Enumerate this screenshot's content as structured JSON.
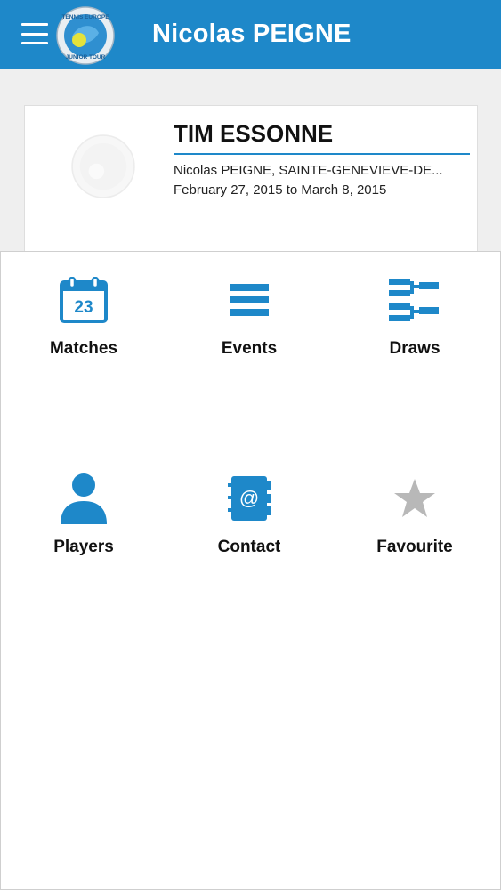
{
  "header": {
    "title": "Nicolas PEIGNE",
    "logo_text_top": "TENNIS EUROPE",
    "logo_text_bottom": "JUNIOR TOUR",
    "color": "#1e88c9"
  },
  "tournament": {
    "name": "TIM ESSONNE",
    "organizer_location": "Nicolas PEIGNE, SAINTE-GENEVIEVE-DE...",
    "dates": "February 27, 2015 to March 8, 2015"
  },
  "menu": {
    "items": [
      {
        "label": "Matches",
        "icon": "calendar-icon",
        "icon_text": "23"
      },
      {
        "label": "Events",
        "icon": "list-icon"
      },
      {
        "label": "Draws",
        "icon": "draws-bracket-icon"
      },
      {
        "label": "Players",
        "icon": "person-icon"
      },
      {
        "label": "Contact",
        "icon": "address-book-icon",
        "icon_text": "@"
      },
      {
        "label": "Favourite",
        "icon": "star-icon"
      }
    ],
    "icon_color": "#1e88c9",
    "inactive_icon_color": "#b8b8b8"
  }
}
